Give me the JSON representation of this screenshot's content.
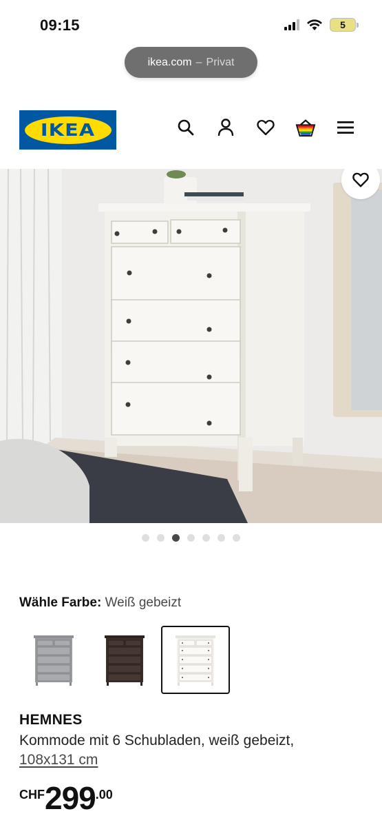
{
  "status_bar": {
    "time": "09:15",
    "battery": "5"
  },
  "browser": {
    "domain": "ikea.com",
    "separator": "–",
    "mode": "Privat"
  },
  "header": {
    "logo_text": "IKEA",
    "brand_colors": {
      "blue": "#0058a3",
      "yellow": "#ffdb00"
    },
    "icons": [
      "search-icon",
      "user-icon",
      "heart-icon",
      "cart-icon",
      "menu-icon"
    ]
  },
  "gallery": {
    "total_images": 7,
    "active_index": 2
  },
  "color_picker": {
    "label": "Wähle Farbe:",
    "value": "Weiß gebeizt",
    "options": [
      {
        "name": "grey",
        "color": "#9a9ca0",
        "selected": false
      },
      {
        "name": "black-brown",
        "color": "#3b2f2a",
        "selected": false
      },
      {
        "name": "white",
        "color": "#f4f2ee",
        "selected": true
      }
    ]
  },
  "product": {
    "name": "HEMNES",
    "description": "Kommode mit 6 Schubladen, weiß gebeizt,",
    "dimensions": "108x131 cm",
    "price": {
      "currency": "CHF",
      "integer": "299",
      "decimal": ".00"
    }
  }
}
